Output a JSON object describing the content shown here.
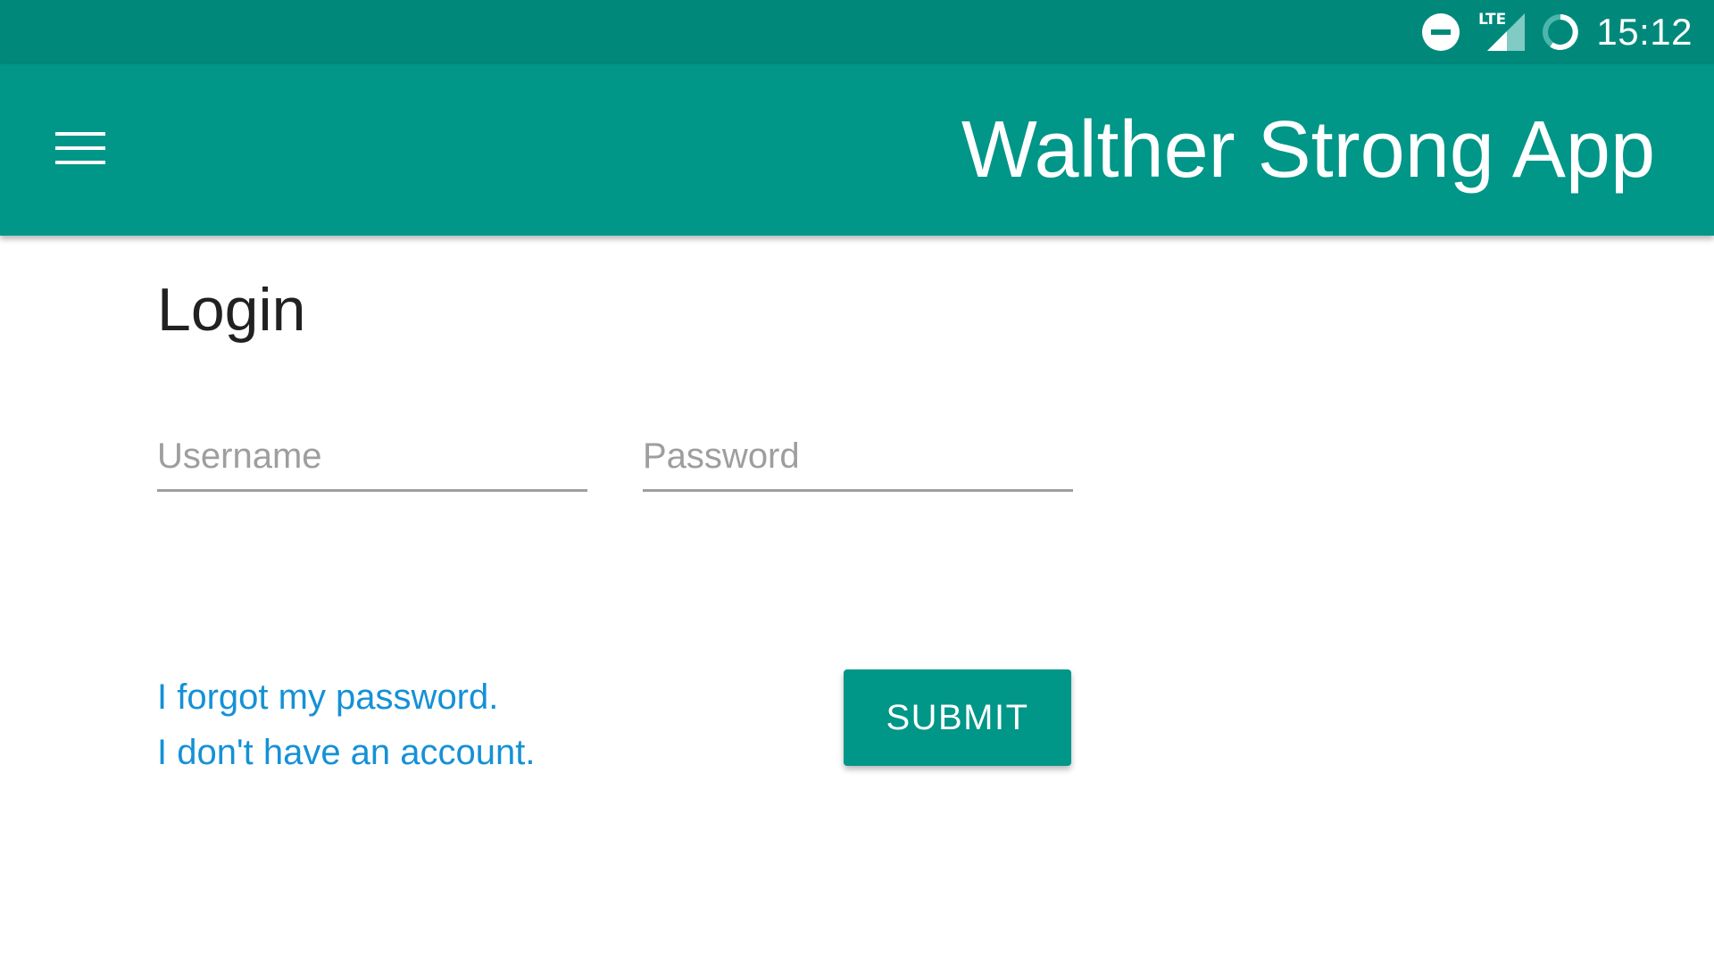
{
  "status_bar": {
    "network_label": "LTE",
    "time": "15:12",
    "icons": [
      "do-not-disturb-icon",
      "lte-signal-icon",
      "battery-icon"
    ]
  },
  "app_bar": {
    "title": "Walther Strong App",
    "menu_icon": "hamburger-menu-icon"
  },
  "login": {
    "title": "Login",
    "username": {
      "placeholder": "Username",
      "value": ""
    },
    "password": {
      "placeholder": "Password",
      "value": ""
    },
    "forgot_password_link": "I forgot my password.",
    "no_account_link": "I don't have an account.",
    "submit_label": "SUBMIT"
  },
  "colors": {
    "status_bar": "#00897b",
    "app_bar": "#009688",
    "link": "#1591d6",
    "button": "#009688"
  }
}
